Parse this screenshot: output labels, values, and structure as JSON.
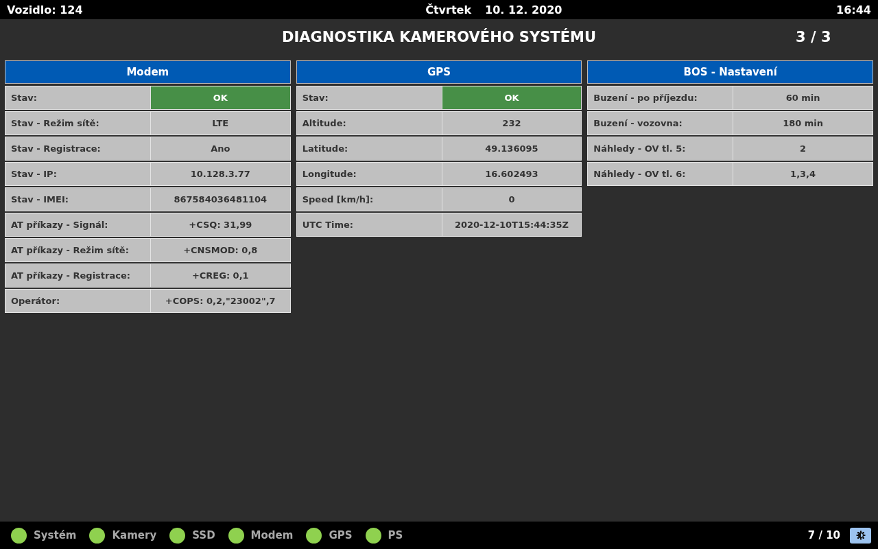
{
  "top_bar": {
    "vehicle": "Vozidlo: 124",
    "day": "Čtvrtek",
    "date": "10. 12. 2020",
    "time": "16:44"
  },
  "title": "DIAGNOSTIKA KAMEROVÉHO SYSTÉMU",
  "page": "3 / 3",
  "panels": [
    {
      "title": "Modem",
      "rows": [
        {
          "label": "Stav:",
          "value": "OK",
          "kind": "status"
        },
        {
          "label": "Stav - Režim sítě:",
          "value": "LTE",
          "kind": "value"
        },
        {
          "label": "Stav - Registrace:",
          "value": "Ano",
          "kind": "value"
        },
        {
          "label": "Stav - IP:",
          "value": "10.128.3.77",
          "kind": "value"
        },
        {
          "label": "Stav - IMEI:",
          "value": "867584036481104",
          "kind": "value"
        },
        {
          "label": "AT příkazy - Signál:",
          "value": "+CSQ: 31,99",
          "kind": "value"
        },
        {
          "label": "AT příkazy - Režim sítě:",
          "value": "+CNSMOD: 0,8",
          "kind": "value"
        },
        {
          "label": "AT příkazy - Registrace:",
          "value": "+CREG: 0,1",
          "kind": "value"
        },
        {
          "label": "Operátor:",
          "value": "+COPS: 0,2,\"23002\",7",
          "kind": "value"
        }
      ]
    },
    {
      "title": "GPS",
      "rows": [
        {
          "label": "Stav:",
          "value": "OK",
          "kind": "status"
        },
        {
          "label": "Altitude:",
          "value": "232",
          "kind": "value"
        },
        {
          "label": "Latitude:",
          "value": "49.136095",
          "kind": "value"
        },
        {
          "label": "Longitude:",
          "value": "16.602493",
          "kind": "value"
        },
        {
          "label": "Speed [km/h]:",
          "value": "0",
          "kind": "value"
        },
        {
          "label": "UTC Time:",
          "value": "2020-12-10T15:44:35Z",
          "kind": "value"
        }
      ]
    },
    {
      "title": "BOS - Nastavení",
      "rows": [
        {
          "label": "Buzení - po příjezdu:",
          "value": "60 min",
          "kind": "value"
        },
        {
          "label": "Buzení - vozovna:",
          "value": "180 min",
          "kind": "value"
        },
        {
          "label": "Náhledy - OV tl. 5:",
          "value": "2",
          "kind": "value"
        },
        {
          "label": "Náhledy - OV tl. 6:",
          "value": "1,3,4",
          "kind": "value"
        }
      ]
    }
  ],
  "status_bar": {
    "indicators": [
      {
        "label": "Systém",
        "color": "#8fd14f"
      },
      {
        "label": "Kamery",
        "color": "#8fd14f"
      },
      {
        "label": "SSD",
        "color": "#8fd14f"
      },
      {
        "label": "Modem",
        "color": "#8fd14f"
      },
      {
        "label": "GPS",
        "color": "#8fd14f"
      },
      {
        "label": "PS",
        "color": "#8fd14f"
      }
    ],
    "counter": "7 / 10"
  }
}
